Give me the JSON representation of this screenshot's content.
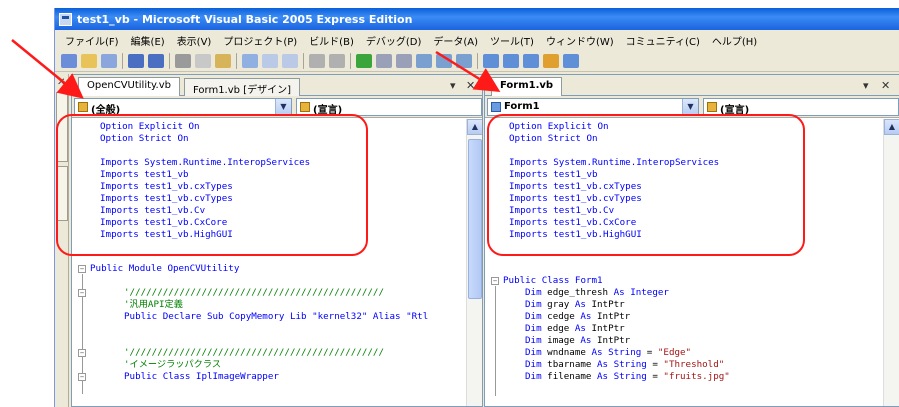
{
  "window": {
    "title": "test1_vb - Microsoft Visual Basic 2005 Express Edition"
  },
  "menu": [
    "ファイル(F)",
    "編集(E)",
    "表示(V)",
    "プロジェクト(P)",
    "ビルド(B)",
    "デバッグ(D)",
    "データ(A)",
    "ツール(T)",
    "ウィンドウ(W)",
    "コミュニティ(C)",
    "ヘルプ(H)"
  ],
  "left_pane": {
    "tabs": [
      "OpenCVUtility.vb",
      "Form1.vb [デザイン]"
    ],
    "combo_left": "(全般)",
    "combo_right": "(宣言)",
    "header_lines": [
      "Option Explicit On",
      "Option Strict On",
      "",
      "Imports System.Runtime.InteropServices",
      "Imports test1_vb",
      "Imports test1_vb.cxTypes",
      "Imports test1_vb.cvTypes",
      "Imports test1_vb.Cv",
      "Imports test1_vb.CxCore",
      "Imports test1_vb.HighGUI"
    ],
    "module_line": "Public Module OpenCVUtility",
    "comment_bar_1": "'//////////////////////////////////////////////",
    "comment_1": "'汎用API定義",
    "declare_line": "Public Declare Sub CopyMemory Lib \"kernel32\" Alias \"Rtl",
    "comment_bar_2": "'//////////////////////////////////////////////",
    "comment_2": "'イメージラッパクラス",
    "class_line": "Public Class IplImageWrapper"
  },
  "right_pane": {
    "tab": "Form1.vb",
    "combo_left": "Form1",
    "combo_right": "(宣言)",
    "header_lines": [
      "Option Explicit On",
      "Option Strict On",
      "",
      "Imports System.Runtime.InteropServices",
      "Imports test1_vb",
      "Imports test1_vb.cxTypes",
      "Imports test1_vb.cvTypes",
      "Imports test1_vb.Cv",
      "Imports test1_vb.CxCore",
      "Imports test1_vb.HighGUI"
    ],
    "class_line": "Public Class Form1",
    "dims": [
      {
        "name": "edge_thresh",
        "type": "Integer"
      },
      {
        "name": "gray",
        "type": "IntPtr"
      },
      {
        "name": "cedge",
        "type": "IntPtr"
      },
      {
        "name": "edge",
        "type": "IntPtr"
      },
      {
        "name": "image",
        "type": "IntPtr"
      },
      {
        "name": "wndname",
        "type": "String",
        "value": "\"Edge\""
      },
      {
        "name": "tbarname",
        "type": "String",
        "value": "\"Threshold\""
      },
      {
        "name": "filename",
        "type": "String",
        "value": "\"fruits.jpg\""
      }
    ]
  },
  "colors": {
    "keyword": "#0000ff",
    "string": "#a31515",
    "comment": "#008000",
    "annotation": "#ff1a1a"
  }
}
